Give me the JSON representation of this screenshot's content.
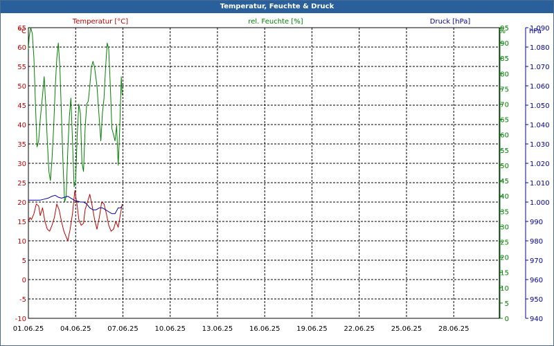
{
  "window_title": "Temperatur, Feuchte & Druck",
  "colors": {
    "titlebar": "#29609b",
    "temperature": "#c00000",
    "humidity": "#008000",
    "pressure": "#0000a0",
    "grid": "#000000"
  },
  "chart_data": {
    "type": "line",
    "title": "Temperatur, Feuchte & Druck",
    "x_ticks": [
      "01.06.25",
      "04.06.25",
      "07.06.25",
      "10.06.25",
      "13.06.25",
      "16.06.25",
      "19.06.25",
      "22.06.25",
      "25.06.25",
      "28.06.25"
    ],
    "xlim": [
      "01.06.25",
      "03.07.25"
    ],
    "grid": true,
    "axes": {
      "temperature": {
        "label": "Temperatur [°C]",
        "unit": "°C",
        "ylim": [
          -10,
          65
        ],
        "ticks": [
          "-10",
          "-5",
          "0",
          "5",
          "10",
          "15",
          "20",
          "25",
          "30",
          "35",
          "40",
          "45",
          "50",
          "55",
          "60",
          "65"
        ]
      },
      "humidity": {
        "label": "rel. Feuchte [%]",
        "unit": "%",
        "ylim": [
          0,
          95
        ],
        "ticks": [
          "0",
          "5",
          "10",
          "15",
          "20",
          "25",
          "30",
          "35",
          "40",
          "45",
          "50",
          "55",
          "60",
          "65",
          "70",
          "75",
          "80",
          "85",
          "90",
          "95"
        ]
      },
      "pressure": {
        "label": "Druck [hPa]",
        "unit": "hPa",
        "ylim": [
          940,
          1090
        ],
        "ticks": [
          "940",
          "950",
          "960",
          "970",
          "980",
          "990",
          "1.000",
          "1.010",
          "1.020",
          "1.030",
          "1.040",
          "1.050",
          "1.060",
          "1.070",
          "1.080",
          "1.090"
        ]
      }
    },
    "series": [
      {
        "name": "Temperatur [°C]",
        "axis": "temperature",
        "color": "#c00000",
        "days": [
          0.0,
          0.1,
          0.2,
          0.35,
          0.5,
          0.65,
          0.75,
          0.9,
          1.05,
          1.2,
          1.35,
          1.5,
          1.65,
          1.8,
          1.95,
          2.1,
          2.25,
          2.4,
          2.5,
          2.65,
          2.8,
          2.95,
          3.1,
          3.2,
          3.35,
          3.5,
          3.6,
          3.75,
          3.9,
          4.05,
          4.2,
          4.35,
          4.5,
          4.65,
          4.8,
          4.95,
          5.1,
          5.25,
          5.4,
          5.55,
          5.7,
          5.85,
          5.95
        ],
        "values": [
          15,
          16,
          15.5,
          17,
          19.5,
          19,
          16.5,
          18.5,
          15,
          13,
          12.5,
          14,
          16,
          19.5,
          18,
          15,
          12.5,
          11,
          10,
          13,
          17,
          23,
          19,
          15.5,
          14,
          14.5,
          18,
          20,
          22,
          19,
          15.5,
          13,
          16,
          20,
          19.5,
          17,
          14,
          12.5,
          13,
          15,
          13.5,
          17,
          19.5
        ]
      },
      {
        "name": "rel. Feuchte [%]",
        "axis": "humidity",
        "color": "#008000",
        "days": [
          0.0,
          0.05,
          0.15,
          0.25,
          0.35,
          0.45,
          0.55,
          0.65,
          0.75,
          0.9,
          1.0,
          1.1,
          1.2,
          1.3,
          1.4,
          1.5,
          1.6,
          1.7,
          1.8,
          1.9,
          2.0,
          2.1,
          2.2,
          2.3,
          2.4,
          2.5,
          2.6,
          2.7,
          2.8,
          2.9,
          3.0,
          3.1,
          3.2,
          3.3,
          3.4,
          3.5,
          3.6,
          3.7,
          3.8,
          3.9,
          4.0,
          4.1,
          4.2,
          4.35,
          4.5,
          4.6,
          4.7,
          4.8,
          4.9,
          5.0,
          5.1,
          5.2,
          5.3,
          5.4,
          5.5,
          5.6,
          5.7,
          5.8,
          5.9,
          5.95
        ],
        "values": [
          88,
          92,
          95,
          93,
          85,
          70,
          56,
          58,
          65,
          73,
          79,
          70,
          58,
          48,
          45,
          52,
          62,
          75,
          85,
          90,
          82,
          66,
          50,
          38,
          40,
          55,
          66,
          72,
          58,
          43,
          45,
          60,
          70,
          67,
          51,
          48,
          62,
          70,
          71,
          76,
          82,
          84,
          82,
          76,
          65,
          58,
          67,
          72,
          82,
          90,
          88,
          76,
          62,
          60,
          58,
          63,
          50,
          62,
          79,
          73
        ]
      },
      {
        "name": "Druck [hPa]",
        "axis": "pressure",
        "color": "#0000a0",
        "days": [
          0.0,
          0.25,
          0.5,
          0.75,
          1.0,
          1.25,
          1.5,
          1.7,
          1.9,
          2.1,
          2.3,
          2.5,
          2.7,
          2.9,
          3.1,
          3.3,
          3.5,
          3.7,
          3.9,
          4.1,
          4.3,
          4.5,
          4.7,
          4.9,
          5.1,
          5.3,
          5.5,
          5.7,
          5.85,
          5.95
        ],
        "values": [
          1001,
          1001,
          1001,
          1001,
          1001.5,
          1002,
          1003,
          1003.5,
          1002.5,
          1002,
          1002.5,
          1003,
          1002,
          1001,
          1000.5,
          1000,
          1000,
          999,
          997,
          996,
          996,
          997,
          997,
          996,
          995,
          994,
          994,
          997,
          997,
          998
        ]
      }
    ]
  }
}
